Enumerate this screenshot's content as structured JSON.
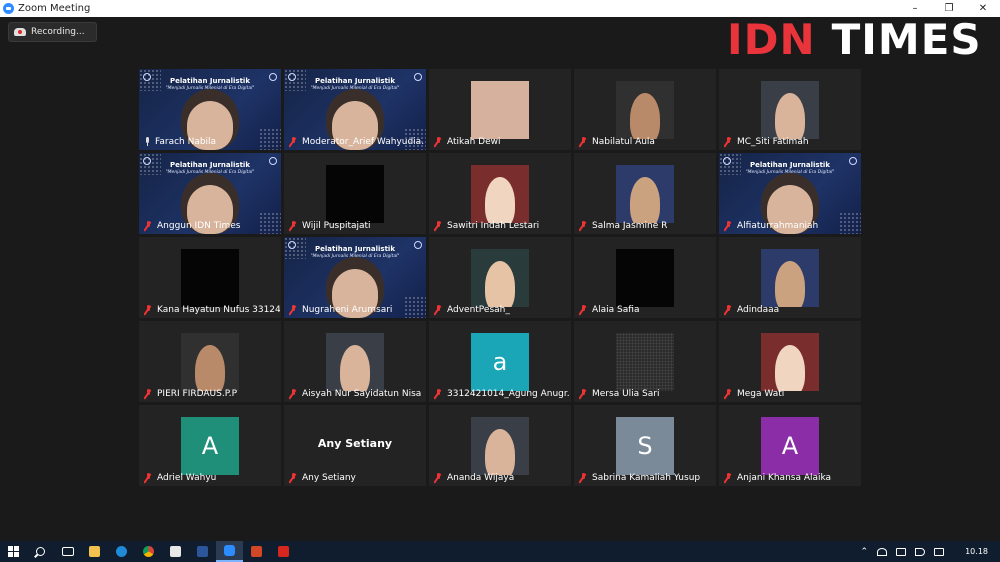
{
  "window": {
    "title": "Zoom Meeting",
    "controls": [
      "minimize",
      "restore",
      "close"
    ]
  },
  "recording": {
    "label": "Recording..."
  },
  "logo": {
    "part1": "IDN",
    "part2": "TIMES"
  },
  "slide": {
    "title": "Pelatihan Jurnalistik",
    "subtitle": "\"Menjadi Jurnalis Milenial di Era Digital\""
  },
  "colors": {
    "active_speaker_outline": "#cfe25a",
    "muted_mic": "#e33333",
    "logo_red": "#e8343a",
    "taskbar": "#0f1d2e"
  },
  "participants": [
    {
      "name": "Farach Nabila",
      "mic": "on",
      "active": true,
      "view": "slide-person"
    },
    {
      "name": "Moderator_Arief Wahyudia...",
      "mic": "muted",
      "view": "slide-person"
    },
    {
      "name": "Atikah Dewi",
      "mic": "muted",
      "view": "beige"
    },
    {
      "name": "Nabilatul Aula",
      "mic": "muted",
      "view": "photo"
    },
    {
      "name": "MC_Siti Fatimah",
      "mic": "muted",
      "view": "photo"
    },
    {
      "name": "Anggun IDN Times",
      "mic": "muted",
      "view": "slide-person"
    },
    {
      "name": "Wijil Puspitajati",
      "mic": "muted",
      "view": "black"
    },
    {
      "name": "Sawitri Indah Lestari",
      "mic": "muted",
      "view": "photo"
    },
    {
      "name": "Salma Jasmine R",
      "mic": "muted",
      "view": "photo"
    },
    {
      "name": "Alfiaturrahmaniah",
      "mic": "muted",
      "view": "slide-person"
    },
    {
      "name": "Kana Hayatun Nufus 33124...",
      "mic": "muted",
      "view": "black"
    },
    {
      "name": "Nugraheni Arumsari",
      "mic": "muted",
      "view": "slide-person"
    },
    {
      "name": "AdventPesah_",
      "mic": "muted",
      "view": "photo"
    },
    {
      "name": "Alaia Safia",
      "mic": "muted",
      "view": "black"
    },
    {
      "name": "Adindaaa",
      "mic": "muted",
      "view": "photo"
    },
    {
      "name": "PIERI FIRDAUS.P.P",
      "mic": "muted",
      "view": "photo"
    },
    {
      "name": "Aisyah Nur Sayidatun Nisa",
      "mic": "muted",
      "view": "photo"
    },
    {
      "name": "3312421014_Agung Anugr...",
      "mic": "muted",
      "view": "letter",
      "letter": "a",
      "letter_color": "#1aa6b7"
    },
    {
      "name": "Mersa Ulia Sari",
      "mic": "muted",
      "view": "noise"
    },
    {
      "name": "Mega Wati",
      "mic": "muted",
      "view": "photo"
    },
    {
      "name": "Adriel Wahyu",
      "mic": "muted",
      "view": "letter",
      "letter": "A",
      "letter_color": "#1f8f7a"
    },
    {
      "name": "Any Setiany",
      "mic": "muted",
      "view": "name-only",
      "display": "Any Setiany"
    },
    {
      "name": "Ananda Wijaya",
      "mic": "muted",
      "view": "photo"
    },
    {
      "name": "Sabrina Kamaliah Yusup",
      "mic": "muted",
      "view": "letter",
      "letter": "S",
      "letter_color": "#7a8a99"
    },
    {
      "name": "Anjani Khansa Alaika",
      "mic": "muted",
      "view": "letter",
      "letter": "A",
      "letter_color": "#8a2da6"
    }
  ],
  "taskbar": {
    "icons": [
      "windows-start-icon",
      "search-icon",
      "task-view-icon",
      "file-explorer-icon",
      "edge-icon",
      "chrome-icon",
      "store-icon",
      "word-icon",
      "zoom-icon",
      "powerpoint-icon",
      "acrobat-icon"
    ],
    "time": "10.18"
  }
}
